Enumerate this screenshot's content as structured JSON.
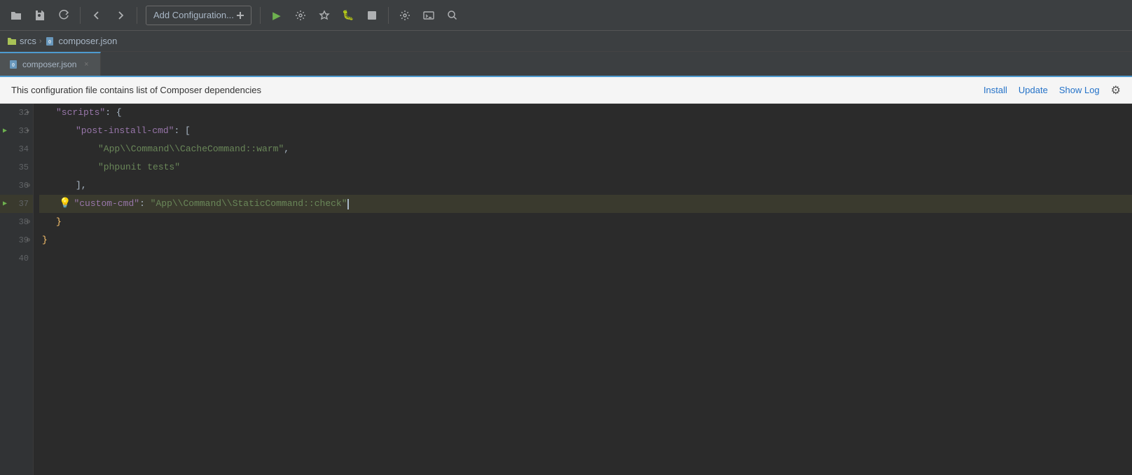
{
  "toolbar": {
    "add_config_label": "Add Configuration...",
    "buttons": [
      "open-folder",
      "save",
      "refresh",
      "back",
      "forward",
      "add-config",
      "run",
      "build",
      "coverage",
      "debug-run",
      "stop",
      "settings",
      "run-terminal",
      "search"
    ]
  },
  "breadcrumb": {
    "root": "srcs",
    "file": "composer.json"
  },
  "tab": {
    "label": "composer.json",
    "close": "×"
  },
  "info_bar": {
    "message": "This configuration file contains list of Composer dependencies",
    "install_label": "Install",
    "update_label": "Update",
    "show_log_label": "Show Log"
  },
  "code_lines": [
    {
      "num": 32,
      "indent": 1,
      "content": "\"scripts\": {",
      "has_fold": true,
      "fold_type": "open"
    },
    {
      "num": 33,
      "indent": 2,
      "content": "\"post-install-cmd\": [",
      "has_fold": true,
      "fold_type": "open",
      "has_run": true
    },
    {
      "num": 34,
      "indent": 3,
      "content": "\"App\\\\Command\\\\CacheCommand::warm\",",
      "has_run": false
    },
    {
      "num": 35,
      "indent": 3,
      "content": "\"phpunit tests\"",
      "has_run": false
    },
    {
      "num": 36,
      "indent": 2,
      "content": "],",
      "has_fold": false
    },
    {
      "num": 37,
      "indent": 2,
      "content": "\"custom-cmd\": \"App\\\\Command\\\\StaticCommand::check\"",
      "has_fold": false,
      "has_run": true,
      "has_bulb": true,
      "highlighted": true,
      "cursor_at_end": true
    },
    {
      "num": 38,
      "indent": 1,
      "content": "}",
      "has_fold": false
    },
    {
      "num": 39,
      "indent": 0,
      "content": "}",
      "has_fold": false
    },
    {
      "num": 40,
      "indent": 0,
      "content": "",
      "has_fold": false
    }
  ],
  "colors": {
    "accent_blue": "#4e9bd0",
    "run_green": "#6eb14f",
    "key_purple": "#9876aa",
    "str_green": "#6a8759",
    "bulb_yellow": "#f0c040"
  }
}
